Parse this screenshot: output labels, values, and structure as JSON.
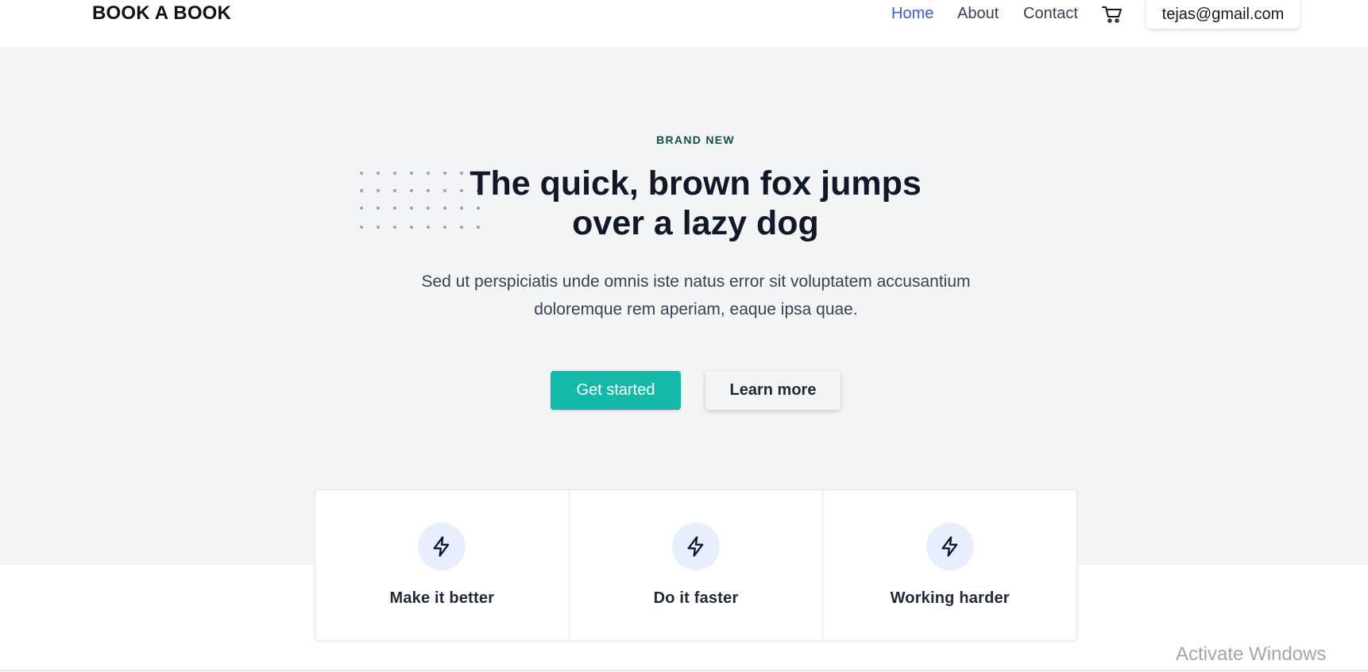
{
  "navbar": {
    "brand": "BOOK A BOOK",
    "links": [
      {
        "label": "Home",
        "active": true
      },
      {
        "label": "About",
        "active": false
      },
      {
        "label": "Contact",
        "active": false
      }
    ],
    "cart_icon": "cart-icon",
    "user_email": "tejas@gmail.com"
  },
  "hero": {
    "eyebrow": "BRAND NEW",
    "headline_line1": "The quick, brown fox jumps",
    "headline_line2": "over a lazy dog",
    "subtext": "Sed ut perspiciatis unde omnis iste natus error sit voluptatem accusantium doloremque rem aperiam, eaque ipsa quae.",
    "primary_button": "Get started",
    "secondary_button": "Learn more",
    "decoration_icon": "dot-grid"
  },
  "features": [
    {
      "label": "Make it better",
      "icon": "lightning-icon"
    },
    {
      "label": "Do it faster",
      "icon": "lightning-icon"
    },
    {
      "label": "Working harder",
      "icon": "lightning-icon"
    }
  ],
  "watermark": "Activate Windows",
  "colors": {
    "accent": "#14b8a6",
    "link_active": "#3b5bdb",
    "hero_bg": "#f3f4f6",
    "icon_bg": "#e8eefc",
    "eyebrow": "#134e4a"
  }
}
